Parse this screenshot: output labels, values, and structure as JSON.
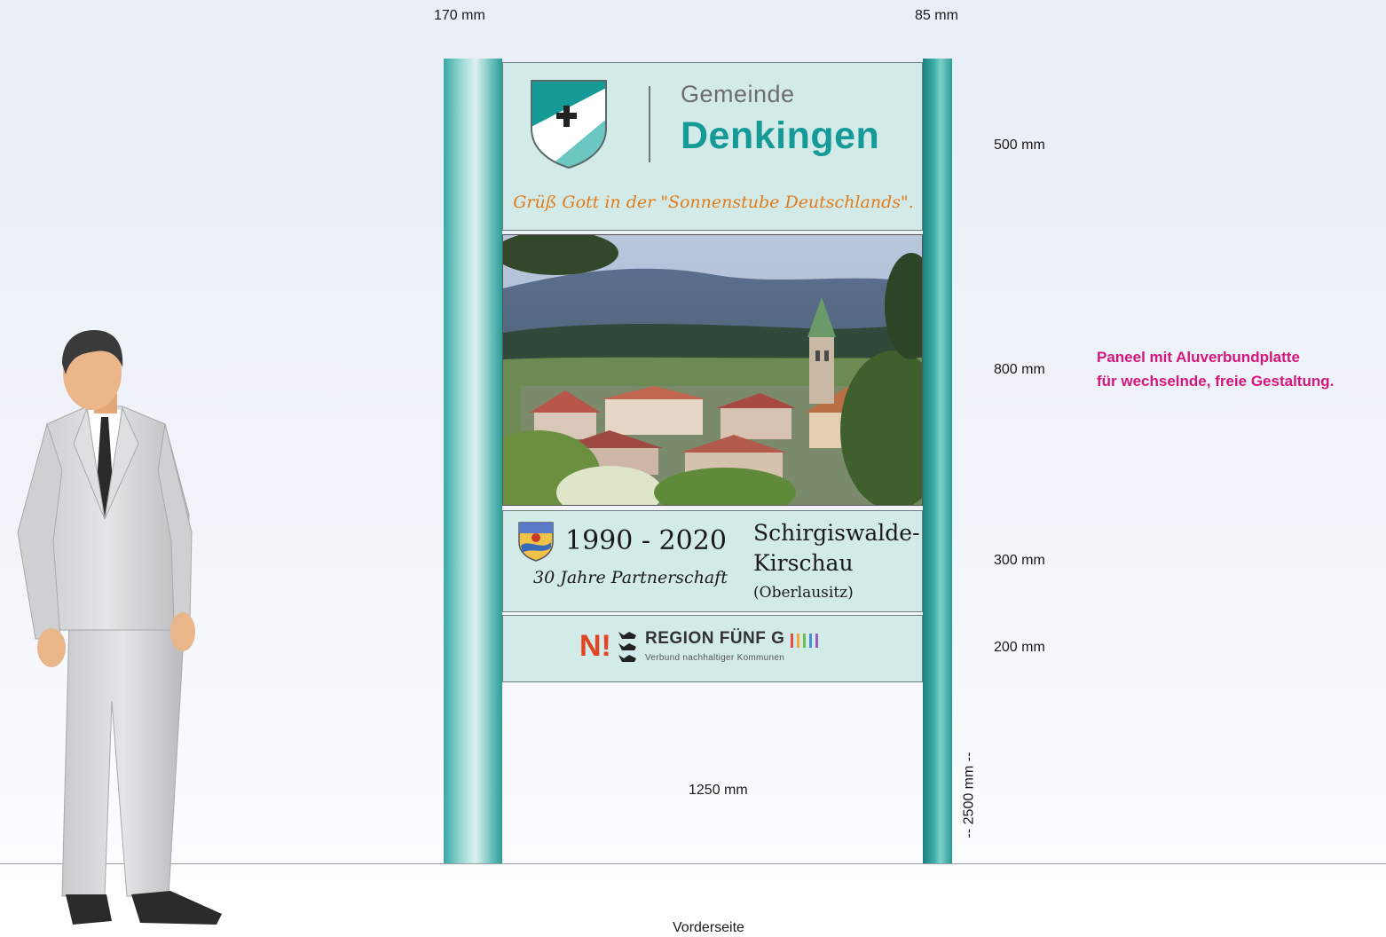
{
  "dimensions": {
    "post_left_width": "170 mm",
    "post_right_width": "85 mm",
    "panel_top_height": "500 mm",
    "panel_photo_height": "800 mm",
    "panel_partner_height": "300 mm",
    "panel_region_height": "200 mm",
    "panel_width": "1250 mm",
    "total_height": "-- 2500 mm --"
  },
  "header_panel": {
    "title_small": "Gemeinde",
    "title_large": "Denkingen",
    "greeting": "Grüß Gott in der \"Sonnenstube Deutschlands\".",
    "shield_color": "#169a98"
  },
  "partner_panel": {
    "years": "1990 - 2020",
    "subtitle": "30 Jahre Partnerschaft",
    "town_line1": "Schirgiswalde-",
    "town_line2": "Kirschau",
    "region": "(Oberlausitz)"
  },
  "region_panel": {
    "logo_letter": "N!",
    "name": "REGION FÜNF G",
    "tagline": "Verbund nachhaltiger Kommunen"
  },
  "annotation": {
    "line1": "Paneel mit Aluverbundplatte",
    "line2": "für wechselnde, freie Gestaltung.",
    "color": "#d6157f"
  },
  "caption": "Vorderseite"
}
